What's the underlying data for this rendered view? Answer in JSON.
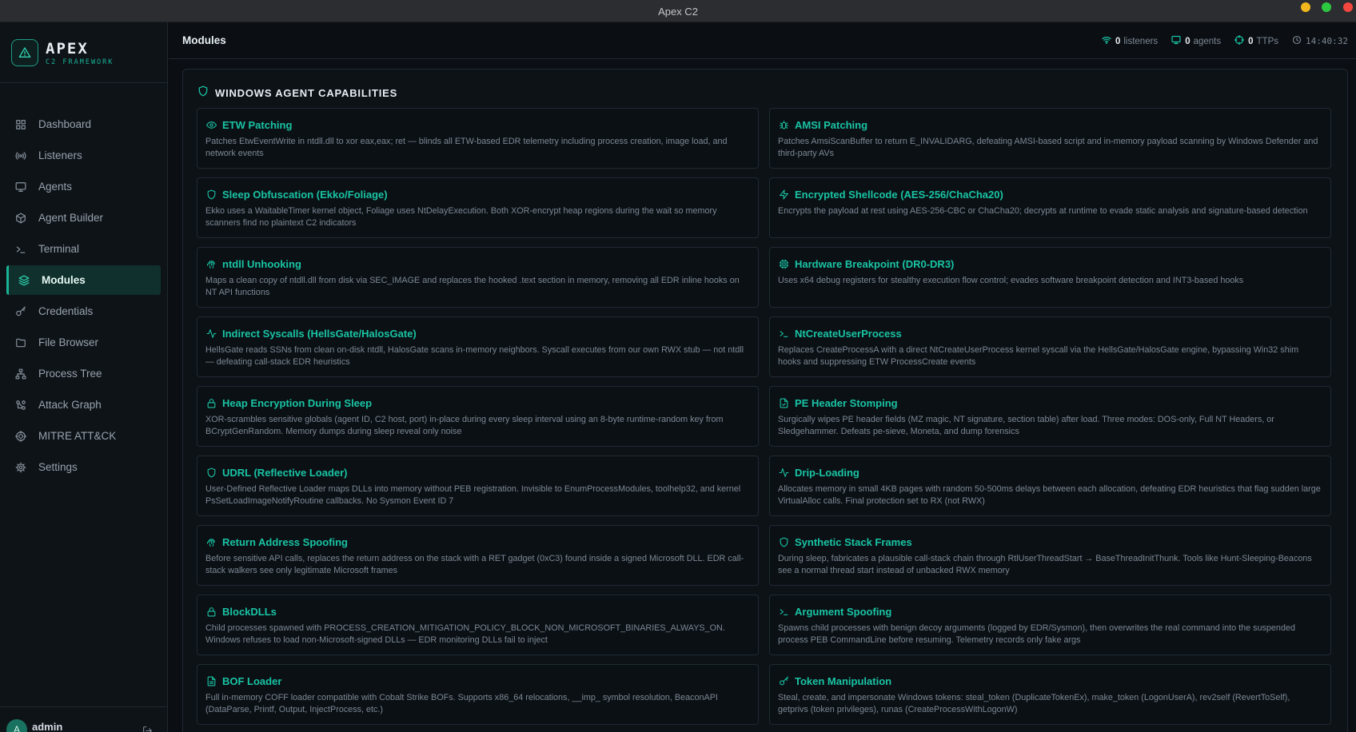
{
  "window": {
    "title": "Apex C2"
  },
  "brand": {
    "name": "APEX",
    "subtitle": "C2 FRAMEWORK"
  },
  "sidebar": {
    "items": [
      {
        "label": "Dashboard",
        "icon": "grid-icon"
      },
      {
        "label": "Listeners",
        "icon": "radio-icon"
      },
      {
        "label": "Agents",
        "icon": "monitor-icon"
      },
      {
        "label": "Agent Builder",
        "icon": "package-icon"
      },
      {
        "label": "Terminal",
        "icon": "terminal-icon"
      },
      {
        "label": "Modules",
        "icon": "layers-icon",
        "active": true
      },
      {
        "label": "Credentials",
        "icon": "key-icon"
      },
      {
        "label": "File Browser",
        "icon": "folder-icon"
      },
      {
        "label": "Process Tree",
        "icon": "tree-icon"
      },
      {
        "label": "Attack Graph",
        "icon": "graph-icon"
      },
      {
        "label": "MITRE ATT&CK",
        "icon": "target-icon"
      },
      {
        "label": "Settings",
        "icon": "gear-icon"
      }
    ]
  },
  "user": {
    "name": "admin",
    "initial": "A"
  },
  "header": {
    "title": "Modules",
    "listeners_count": "0",
    "listeners_label": "listeners",
    "agents_count": "0",
    "agents_label": "agents",
    "ttps_count": "0",
    "ttps_label": "TTPs",
    "clock": "14:40:32"
  },
  "section": {
    "title": "WINDOWS AGENT CAPABILITIES"
  },
  "modules": [
    {
      "title": "ETW Patching",
      "icon": "eye-icon",
      "desc": "Patches EtwEventWrite in ntdll.dll to xor eax,eax; ret — blinds all ETW-based EDR telemetry including process creation, image load, and network events"
    },
    {
      "title": "AMSI Patching",
      "icon": "bug-icon",
      "desc": "Patches AmsiScanBuffer to return E_INVALIDARG, defeating AMSI-based script and in-memory payload scanning by Windows Defender and third-party AVs"
    },
    {
      "title": "Sleep Obfuscation (Ekko/Foliage)",
      "icon": "shield-icon",
      "desc": "Ekko uses a WaitableTimer kernel object, Foliage uses NtDelayExecution. Both XOR-encrypt heap regions during the wait so memory scanners find no plaintext C2 indicators"
    },
    {
      "title": "Encrypted Shellcode (AES-256/ChaCha20)",
      "icon": "zap-icon",
      "desc": "Encrypts the payload at rest using AES-256-CBC or ChaCha20; decrypts at runtime to evade static analysis and signature-based detection"
    },
    {
      "title": "ntdll Unhooking",
      "icon": "fingerprint-icon",
      "desc": "Maps a clean copy of ntdll.dll from disk via SEC_IMAGE and replaces the hooked .text section in memory, removing all EDR inline hooks on NT API functions"
    },
    {
      "title": "Hardware Breakpoint (DR0-DR3)",
      "icon": "cpu-icon",
      "desc": "Uses x64 debug registers for stealthy execution flow control; evades software breakpoint detection and INT3-based hooks"
    },
    {
      "title": "Indirect Syscalls (HellsGate/HalosGate)",
      "icon": "activity-icon",
      "desc": "HellsGate reads SSNs from clean on-disk ntdll, HalosGate scans in-memory neighbors. Syscall executes from our own RWX stub — not ntdll — defeating call-stack EDR heuristics"
    },
    {
      "title": "NtCreateUserProcess",
      "icon": "terminal-icon",
      "desc": "Replaces CreateProcessA with a direct NtCreateUserProcess kernel syscall via the HellsGate/HalosGate engine, bypassing Win32 shim hooks and suppressing ETW ProcessCreate events"
    },
    {
      "title": "Heap Encryption During Sleep",
      "icon": "lock-icon",
      "desc": "XOR-scrambles sensitive globals (agent ID, C2 host, port) in-place during every sleep interval using an 8-byte runtime-random key from BCryptGenRandom. Memory dumps during sleep reveal only noise"
    },
    {
      "title": "PE Header Stomping",
      "icon": "file-icon",
      "desc": "Surgically wipes PE header fields (MZ magic, NT signature, section table) after load. Three modes: DOS-only, Full NT Headers, or Sledgehammer. Defeats pe-sieve, Moneta, and dump forensics"
    },
    {
      "title": "UDRL (Reflective Loader)",
      "icon": "shield-icon",
      "desc": "User-Defined Reflective Loader maps DLLs into memory without PEB registration. Invisible to EnumProcessModules, toolhelp32, and kernel PsSetLoadImageNotifyRoutine callbacks. No Sysmon Event ID 7"
    },
    {
      "title": "Drip-Loading",
      "icon": "activity-icon",
      "desc": "Allocates memory in small 4KB pages with random 50-500ms delays between each allocation, defeating EDR heuristics that flag sudden large VirtualAlloc calls. Final protection set to RX (not RWX)"
    },
    {
      "title": "Return Address Spoofing",
      "icon": "fingerprint-icon",
      "desc": "Before sensitive API calls, replaces the return address on the stack with a RET gadget (0xC3) found inside a signed Microsoft DLL. EDR call-stack walkers see only legitimate Microsoft frames"
    },
    {
      "title": "Synthetic Stack Frames",
      "icon": "shield-icon",
      "desc": "During sleep, fabricates a plausible call-stack chain through RtlUserThreadStart → BaseThreadInitThunk. Tools like Hunt-Sleeping-Beacons see a normal thread start instead of unbacked RWX memory"
    },
    {
      "title": "BlockDLLs",
      "icon": "lock-icon",
      "desc": "Child processes spawned with PROCESS_CREATION_MITIGATION_POLICY_BLOCK_NON_MICROSOFT_BINARIES_ALWAYS_ON. Windows refuses to load non-Microsoft-signed DLLs — EDR monitoring DLLs fail to inject"
    },
    {
      "title": "Argument Spoofing",
      "icon": "terminal-icon",
      "desc": "Spawns child processes with benign decoy arguments (logged by EDR/Sysmon), then overwrites the real command into the suspended process PEB CommandLine before resuming. Telemetry records only fake args"
    },
    {
      "title": "BOF Loader",
      "icon": "file-text-icon",
      "desc": "Full in-memory COFF loader compatible with Cobalt Strike BOFs. Supports x86_64 relocations, __imp_ symbol resolution, BeaconAPI (DataParse, Printf, Output, InjectProcess, etc.)"
    },
    {
      "title": "Token Manipulation",
      "icon": "key-icon",
      "desc": "Steal, create, and impersonate Windows tokens: steal_token (DuplicateTokenEx), make_token (LogonUserA), rev2self (RevertToSelf), getprivs (token privileges), runas (CreateProcessWithLogonW)"
    }
  ],
  "colors": {
    "accent": "#19c4a4",
    "background": "#0b0f14",
    "sidebar": "#0e1318",
    "active_nav": "#0f302c"
  }
}
